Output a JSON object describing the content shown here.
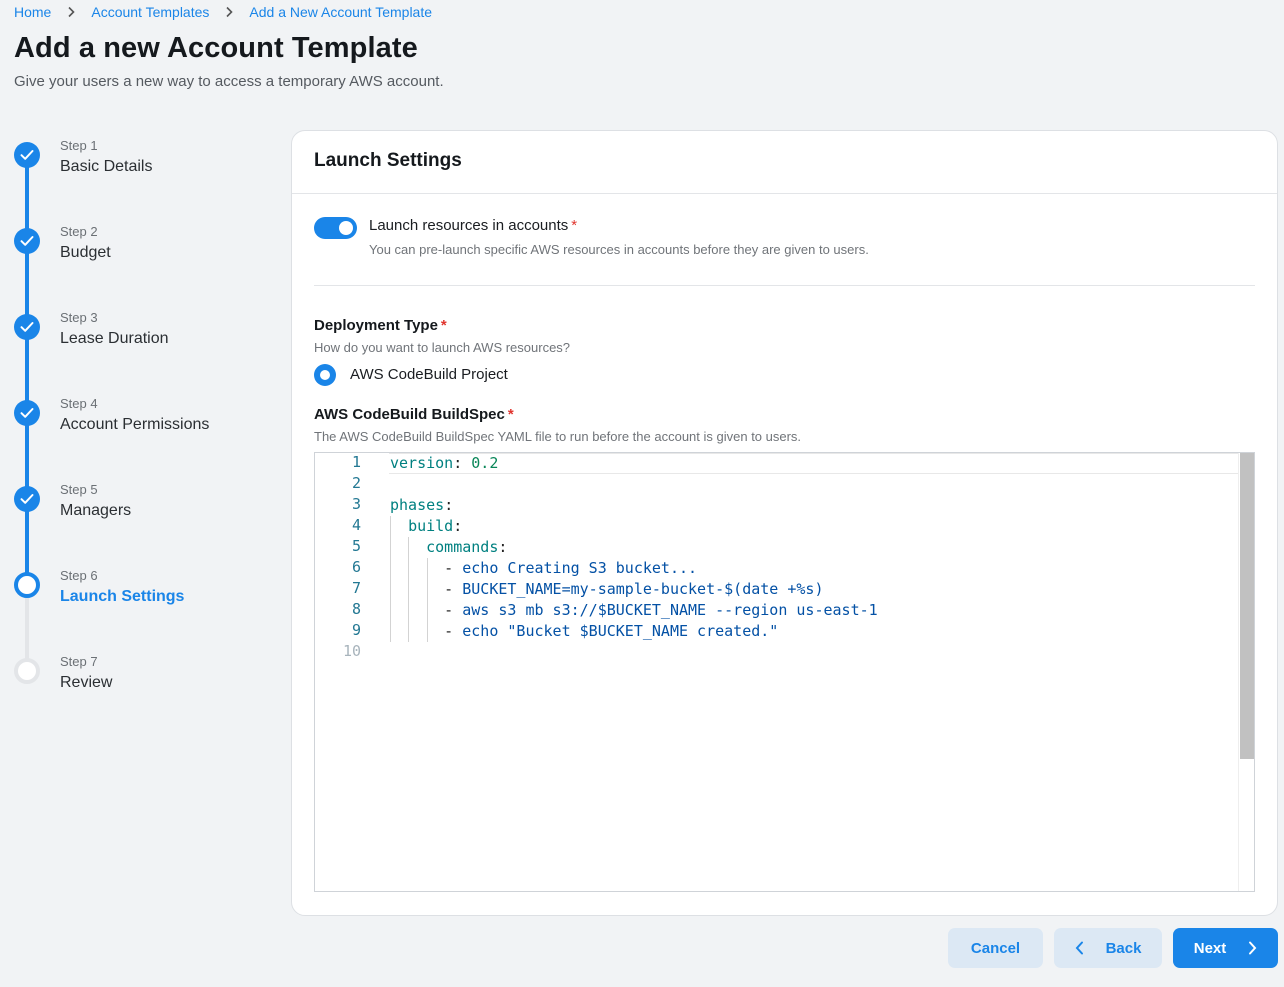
{
  "breadcrumb": {
    "items": [
      "Home",
      "Account Templates",
      "Add a New Account Template"
    ]
  },
  "page": {
    "title": "Add a new Account Template",
    "subtitle": "Give your users a new way to access a temporary AWS account."
  },
  "stepper": {
    "steps": [
      {
        "num": "Step 1",
        "label": "Basic Details",
        "state": "done"
      },
      {
        "num": "Step 2",
        "label": "Budget",
        "state": "done"
      },
      {
        "num": "Step 3",
        "label": "Lease Duration",
        "state": "done"
      },
      {
        "num": "Step 4",
        "label": "Account Permissions",
        "state": "done"
      },
      {
        "num": "Step 5",
        "label": "Managers",
        "state": "done"
      },
      {
        "num": "Step 6",
        "label": "Launch Settings",
        "state": "active"
      },
      {
        "num": "Step 7",
        "label": "Review",
        "state": "pending"
      }
    ]
  },
  "card": {
    "title": "Launch Settings",
    "launch_toggle": {
      "label": "Launch resources in accounts",
      "required_mark": "*",
      "help": "You can pre-launch specific AWS resources in accounts before they are given to users.",
      "enabled": true
    },
    "deployment_type": {
      "title": "Deployment Type",
      "required_mark": "*",
      "help": "How do you want to launch AWS resources?",
      "option_label": "AWS CodeBuild Project",
      "selected": true
    },
    "buildspec": {
      "title": "AWS CodeBuild BuildSpec",
      "required_mark": "*",
      "help": "The AWS CodeBuild BuildSpec YAML file to run before the account is given to users.",
      "line_numbers": [
        "1",
        "2",
        "3",
        "4",
        "5",
        "6",
        "7",
        "8",
        "9",
        "10"
      ],
      "lines": [
        [
          {
            "t": "version",
            "c": "key"
          },
          {
            "t": ": ",
            "c": "punc"
          },
          {
            "t": "0.2",
            "c": "num"
          }
        ],
        [],
        [
          {
            "t": "phases",
            "c": "key"
          },
          {
            "t": ":",
            "c": "punc"
          }
        ],
        [
          {
            "t": "  ",
            "c": "punc"
          },
          {
            "t": "build",
            "c": "key"
          },
          {
            "t": ":",
            "c": "punc"
          }
        ],
        [
          {
            "t": "    ",
            "c": "punc"
          },
          {
            "t": "commands",
            "c": "key"
          },
          {
            "t": ":",
            "c": "punc"
          }
        ],
        [
          {
            "t": "      - ",
            "c": "punc"
          },
          {
            "t": "echo Creating S3 bucket...",
            "c": "str"
          }
        ],
        [
          {
            "t": "      - ",
            "c": "punc"
          },
          {
            "t": "BUCKET_NAME=my-sample-bucket-$(date +%s)",
            "c": "str"
          }
        ],
        [
          {
            "t": "      - ",
            "c": "punc"
          },
          {
            "t": "aws s3 mb s3://$BUCKET_NAME --region us-east-1",
            "c": "str"
          }
        ],
        [
          {
            "t": "      - ",
            "c": "punc"
          },
          {
            "t": "echo \"Bucket $BUCKET_NAME created.\"",
            "c": "str"
          }
        ],
        []
      ]
    }
  },
  "actions": {
    "cancel": "Cancel",
    "back": "Back",
    "next": "Next"
  },
  "colors": {
    "accent": "#1a85e8",
    "required": "#e0352e"
  }
}
